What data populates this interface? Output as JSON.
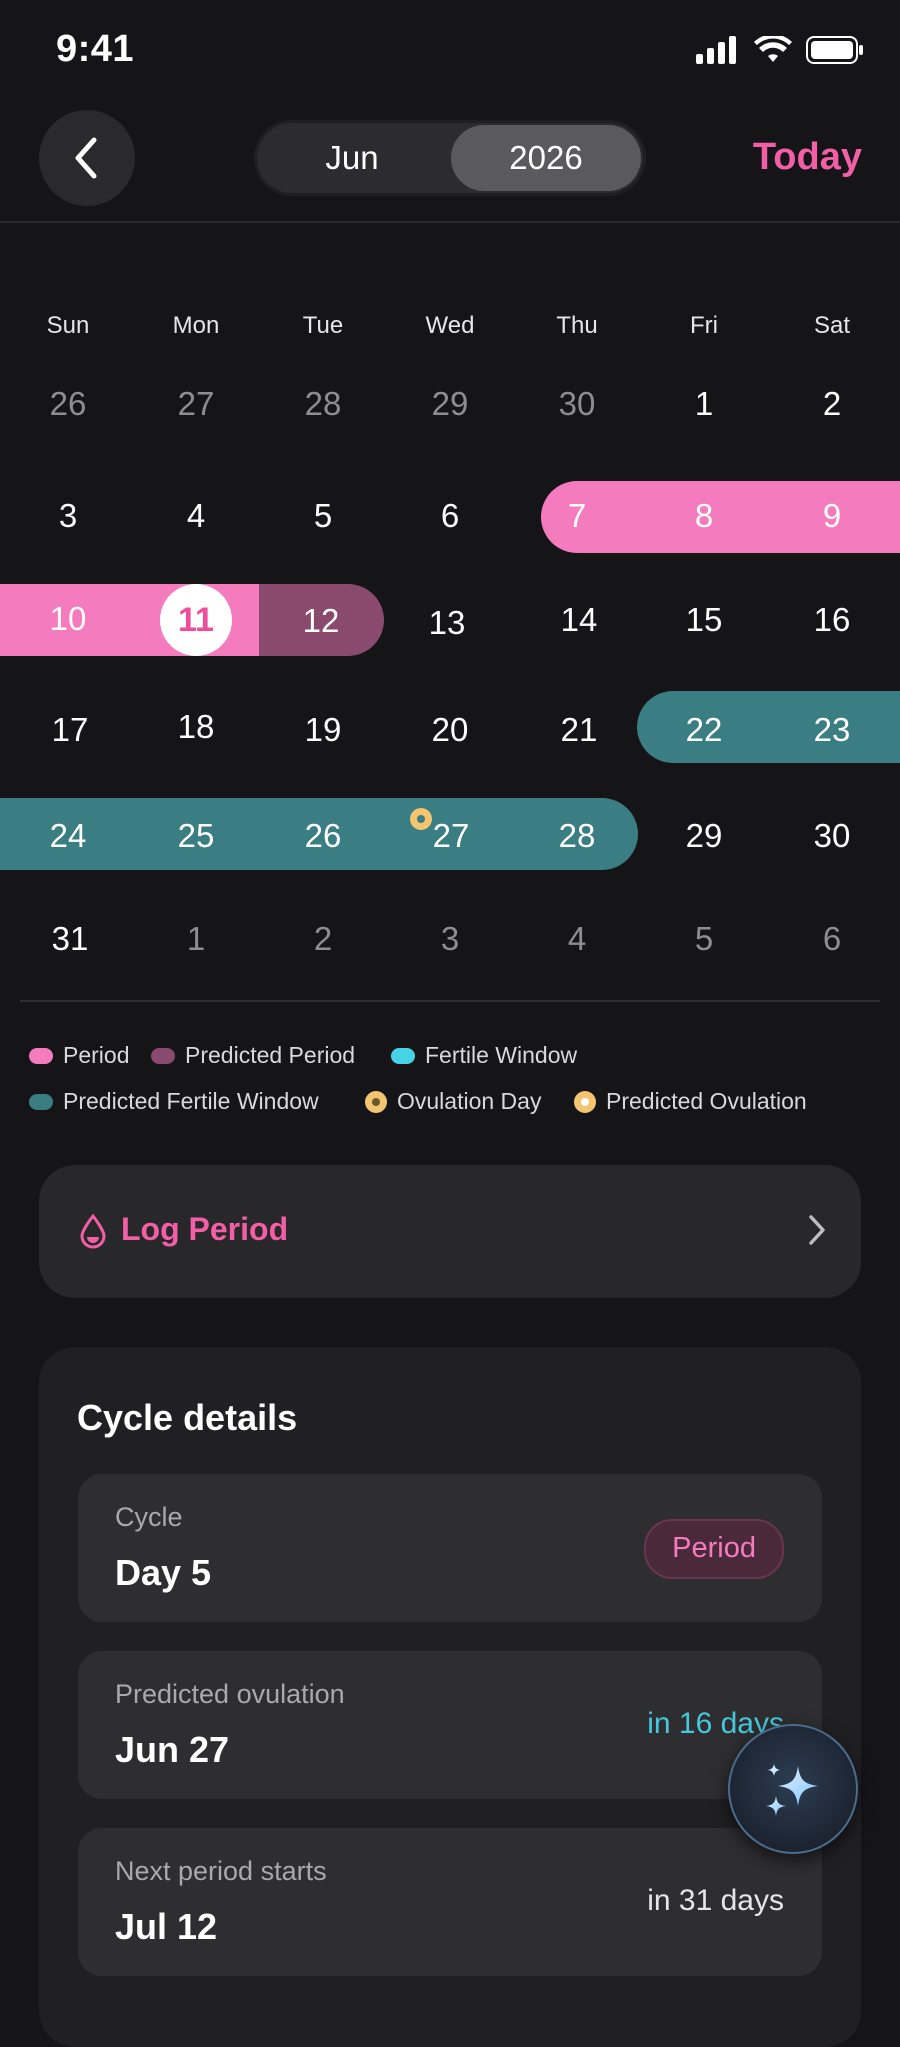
{
  "status_bar": {
    "time": "9:41"
  },
  "header": {
    "month": "Jun",
    "year": "2026",
    "today_label": "Today"
  },
  "calendar": {
    "weekdays": [
      "Sun",
      "Mon",
      "Tue",
      "Wed",
      "Thu",
      "Fri",
      "Sat"
    ],
    "weeks": [
      [
        "26",
        "27",
        "28",
        "29",
        "30",
        "1",
        "2"
      ],
      [
        "3",
        "4",
        "5",
        "6",
        "7",
        "8",
        "9"
      ],
      [
        "10",
        "11",
        "12",
        "13",
        "14",
        "15",
        "16"
      ],
      [
        "17",
        "18",
        "19",
        "20",
        "21",
        "22",
        "23"
      ],
      [
        "24",
        "25",
        "26",
        "27",
        "28",
        "29",
        "30"
      ],
      [
        "31",
        "1",
        "2",
        "3",
        "4",
        "5",
        "6"
      ]
    ],
    "today": "11",
    "colors": {
      "period": "#f47bbd",
      "predicted_period": "#8a4a6e",
      "fertile": "#46d3e6",
      "predicted_fertile": "#3a7d82",
      "ovulation": "#f4c571",
      "accent": "#f25fa6"
    }
  },
  "legend": {
    "period": "Period",
    "predicted_period": "Predicted Period",
    "fertile_window": "Fertile Window",
    "predicted_fertile_window": "Predicted Fertile Window",
    "ovulation_day": "Ovulation Day",
    "predicted_ovulation": "Predicted Ovulation"
  },
  "log_period": {
    "label": "Log Period"
  },
  "cycle_details": {
    "title": "Cycle details",
    "cycle": {
      "label": "Cycle",
      "value": "Day 5",
      "badge": "Period"
    },
    "ovulation": {
      "label": "Predicted ovulation",
      "value": "Jun 27",
      "right": "in 16 days"
    },
    "next_period": {
      "label": "Next period starts",
      "value": "Jul 12",
      "right": "in 31 days"
    }
  }
}
